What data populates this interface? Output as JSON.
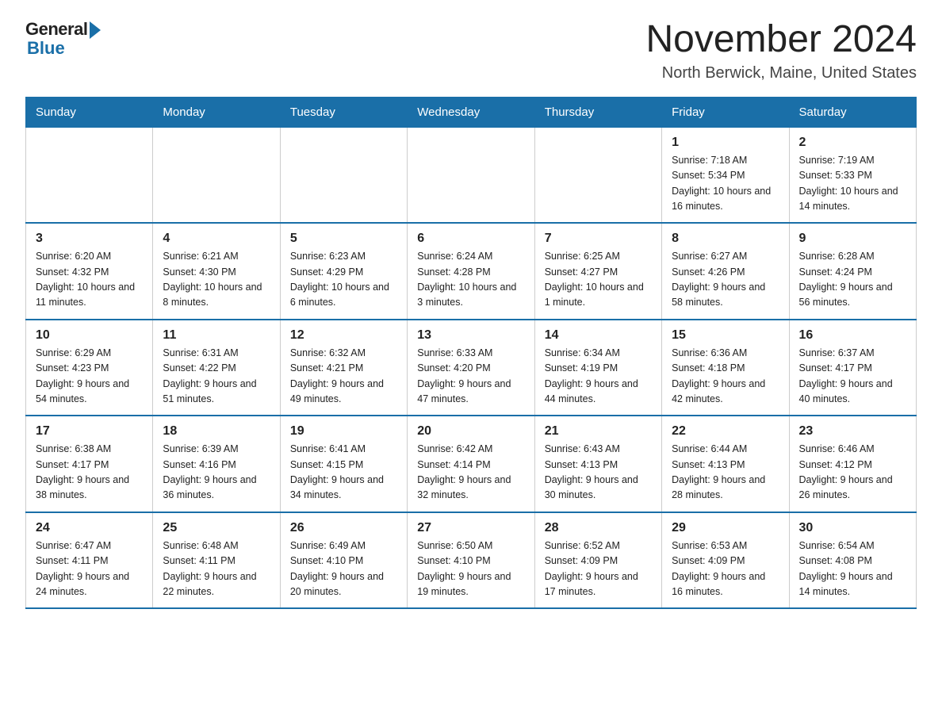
{
  "header": {
    "logo_general": "General",
    "logo_blue": "Blue",
    "month_title": "November 2024",
    "location": "North Berwick, Maine, United States"
  },
  "days_of_week": [
    "Sunday",
    "Monday",
    "Tuesday",
    "Wednesday",
    "Thursday",
    "Friday",
    "Saturday"
  ],
  "weeks": [
    [
      {
        "day": "",
        "info": ""
      },
      {
        "day": "",
        "info": ""
      },
      {
        "day": "",
        "info": ""
      },
      {
        "day": "",
        "info": ""
      },
      {
        "day": "",
        "info": ""
      },
      {
        "day": "1",
        "info": "Sunrise: 7:18 AM\nSunset: 5:34 PM\nDaylight: 10 hours and 16 minutes."
      },
      {
        "day": "2",
        "info": "Sunrise: 7:19 AM\nSunset: 5:33 PM\nDaylight: 10 hours and 14 minutes."
      }
    ],
    [
      {
        "day": "3",
        "info": "Sunrise: 6:20 AM\nSunset: 4:32 PM\nDaylight: 10 hours and 11 minutes."
      },
      {
        "day": "4",
        "info": "Sunrise: 6:21 AM\nSunset: 4:30 PM\nDaylight: 10 hours and 8 minutes."
      },
      {
        "day": "5",
        "info": "Sunrise: 6:23 AM\nSunset: 4:29 PM\nDaylight: 10 hours and 6 minutes."
      },
      {
        "day": "6",
        "info": "Sunrise: 6:24 AM\nSunset: 4:28 PM\nDaylight: 10 hours and 3 minutes."
      },
      {
        "day": "7",
        "info": "Sunrise: 6:25 AM\nSunset: 4:27 PM\nDaylight: 10 hours and 1 minute."
      },
      {
        "day": "8",
        "info": "Sunrise: 6:27 AM\nSunset: 4:26 PM\nDaylight: 9 hours and 58 minutes."
      },
      {
        "day": "9",
        "info": "Sunrise: 6:28 AM\nSunset: 4:24 PM\nDaylight: 9 hours and 56 minutes."
      }
    ],
    [
      {
        "day": "10",
        "info": "Sunrise: 6:29 AM\nSunset: 4:23 PM\nDaylight: 9 hours and 54 minutes."
      },
      {
        "day": "11",
        "info": "Sunrise: 6:31 AM\nSunset: 4:22 PM\nDaylight: 9 hours and 51 minutes."
      },
      {
        "day": "12",
        "info": "Sunrise: 6:32 AM\nSunset: 4:21 PM\nDaylight: 9 hours and 49 minutes."
      },
      {
        "day": "13",
        "info": "Sunrise: 6:33 AM\nSunset: 4:20 PM\nDaylight: 9 hours and 47 minutes."
      },
      {
        "day": "14",
        "info": "Sunrise: 6:34 AM\nSunset: 4:19 PM\nDaylight: 9 hours and 44 minutes."
      },
      {
        "day": "15",
        "info": "Sunrise: 6:36 AM\nSunset: 4:18 PM\nDaylight: 9 hours and 42 minutes."
      },
      {
        "day": "16",
        "info": "Sunrise: 6:37 AM\nSunset: 4:17 PM\nDaylight: 9 hours and 40 minutes."
      }
    ],
    [
      {
        "day": "17",
        "info": "Sunrise: 6:38 AM\nSunset: 4:17 PM\nDaylight: 9 hours and 38 minutes."
      },
      {
        "day": "18",
        "info": "Sunrise: 6:39 AM\nSunset: 4:16 PM\nDaylight: 9 hours and 36 minutes."
      },
      {
        "day": "19",
        "info": "Sunrise: 6:41 AM\nSunset: 4:15 PM\nDaylight: 9 hours and 34 minutes."
      },
      {
        "day": "20",
        "info": "Sunrise: 6:42 AM\nSunset: 4:14 PM\nDaylight: 9 hours and 32 minutes."
      },
      {
        "day": "21",
        "info": "Sunrise: 6:43 AM\nSunset: 4:13 PM\nDaylight: 9 hours and 30 minutes."
      },
      {
        "day": "22",
        "info": "Sunrise: 6:44 AM\nSunset: 4:13 PM\nDaylight: 9 hours and 28 minutes."
      },
      {
        "day": "23",
        "info": "Sunrise: 6:46 AM\nSunset: 4:12 PM\nDaylight: 9 hours and 26 minutes."
      }
    ],
    [
      {
        "day": "24",
        "info": "Sunrise: 6:47 AM\nSunset: 4:11 PM\nDaylight: 9 hours and 24 minutes."
      },
      {
        "day": "25",
        "info": "Sunrise: 6:48 AM\nSunset: 4:11 PM\nDaylight: 9 hours and 22 minutes."
      },
      {
        "day": "26",
        "info": "Sunrise: 6:49 AM\nSunset: 4:10 PM\nDaylight: 9 hours and 20 minutes."
      },
      {
        "day": "27",
        "info": "Sunrise: 6:50 AM\nSunset: 4:10 PM\nDaylight: 9 hours and 19 minutes."
      },
      {
        "day": "28",
        "info": "Sunrise: 6:52 AM\nSunset: 4:09 PM\nDaylight: 9 hours and 17 minutes."
      },
      {
        "day": "29",
        "info": "Sunrise: 6:53 AM\nSunset: 4:09 PM\nDaylight: 9 hours and 16 minutes."
      },
      {
        "day": "30",
        "info": "Sunrise: 6:54 AM\nSunset: 4:08 PM\nDaylight: 9 hours and 14 minutes."
      }
    ]
  ]
}
